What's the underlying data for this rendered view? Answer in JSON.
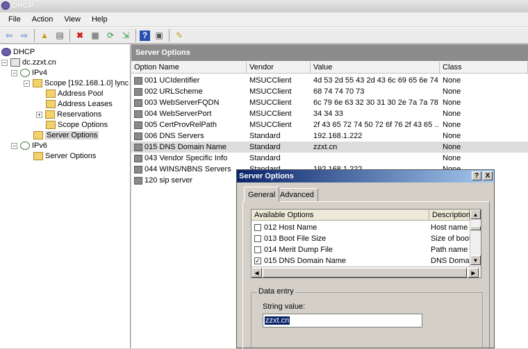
{
  "window": {
    "title": "DHCP"
  },
  "menu": [
    "File",
    "Action",
    "View",
    "Help"
  ],
  "toolbar": [
    "back-icon",
    "forward-icon",
    "up-folder-icon",
    "show-hide-tree-icon",
    "delete-icon",
    "properties-icon",
    "refresh-icon",
    "export-icon",
    "help-icon",
    "view-icon",
    "options-icon"
  ],
  "tree": {
    "root": "DHCP",
    "server": "dc.zzxt.cn",
    "ipv4": "IPv4",
    "scope": "Scope [192.168.1.0] lync",
    "address_pool": "Address Pool",
    "address_leases": "Address Leases",
    "reservations": "Reservations",
    "scope_options": "Scope Options",
    "server_options": "Server Options",
    "ipv6": "IPv6",
    "ipv6_server_options": "Server Options"
  },
  "pane": {
    "title": "Server Options",
    "columns": [
      "Option Name",
      "Vendor",
      "Value",
      "Class"
    ],
    "rows": [
      {
        "name": "001 UCIdentifier",
        "vendor": "MSUCClient",
        "value": "4d 53 2d 55 43 2d 43 6c 69 65 6e 74",
        "class": "None"
      },
      {
        "name": "002 URLScheme",
        "vendor": "MSUCClient",
        "value": "68 74 74 70 73",
        "class": "None"
      },
      {
        "name": "003 WebServerFQDN",
        "vendor": "MSUCClient",
        "value": "6c 79 6e 63 32 30 31 30 2e 7a 7a 78...",
        "class": "None"
      },
      {
        "name": "004 WebServerPort",
        "vendor": "MSUCClient",
        "value": "34 34 33",
        "class": "None"
      },
      {
        "name": "005 CertProvRelPath",
        "vendor": "MSUCClient",
        "value": "2f 43 65 72 74 50 72 6f 76 2f 43 65 ...",
        "class": "None"
      },
      {
        "name": "006 DNS Servers",
        "vendor": "Standard",
        "value": "192.168.1.222",
        "class": "None"
      },
      {
        "name": "015 DNS Domain Name",
        "vendor": "Standard",
        "value": "zzxt.cn",
        "class": "None"
      },
      {
        "name": "043 Vendor Specific Info",
        "vendor": "Standard",
        "value": "",
        "class": "None"
      },
      {
        "name": "044 WINS/NBNS Servers",
        "vendor": "Standard",
        "value": "192.168.1.222",
        "class": "None"
      },
      {
        "name": "120 sip server",
        "vendor": "",
        "value": "",
        "class": ""
      }
    ]
  },
  "dialog": {
    "title": "Server Options",
    "help_button": "?",
    "close_button": "X",
    "tabs": [
      "General",
      "Advanced"
    ],
    "list_columns": [
      "Available Options",
      "Description"
    ],
    "options": [
      {
        "name": "012 Host Name",
        "desc": "Host name f",
        "checked": false
      },
      {
        "name": "013 Boot File Size",
        "desc": "Size of boot",
        "checked": false
      },
      {
        "name": "014 Merit Dump File",
        "desc": "Path name f",
        "checked": false
      },
      {
        "name": "015 DNS Domain Name",
        "desc": "DNS Domai",
        "checked": true
      }
    ],
    "data_entry_label": "Data entry",
    "string_value_label": "String value:",
    "string_value": "zzxt.cn"
  }
}
